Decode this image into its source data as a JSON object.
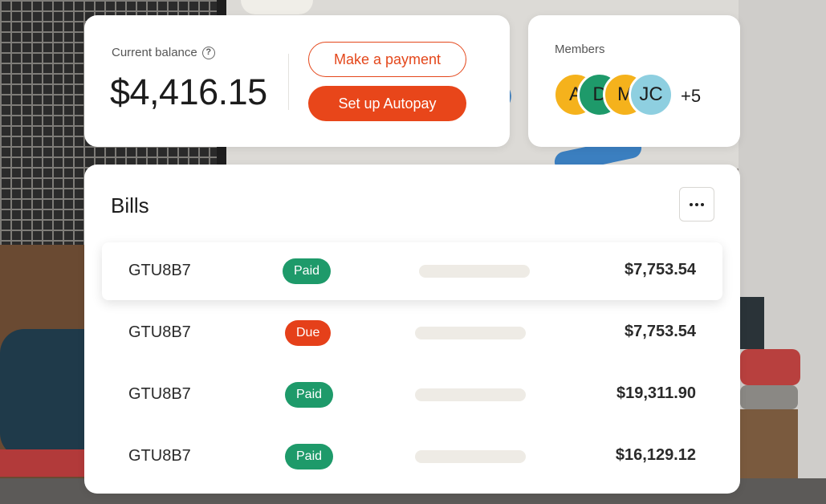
{
  "colors": {
    "accent": "#e8461a",
    "paid": "#1e9a6a",
    "due": "#e5401a",
    "placeholder": "#eeebe5"
  },
  "balance": {
    "label": "Current balance",
    "help_icon": "question-circle-icon",
    "help_glyph": "?",
    "amount": "$4,416.15",
    "make_payment": "Make a payment",
    "setup_autopay": "Set up Autopay"
  },
  "members": {
    "label": "Members",
    "avatars": [
      {
        "initials": "A",
        "color": "#f5b21c"
      },
      {
        "initials": "D",
        "color": "#1e9a6a"
      },
      {
        "initials": "M",
        "color": "#f5b21c"
      },
      {
        "initials": "JC",
        "color": "#8ecfe0"
      }
    ],
    "more": "+5"
  },
  "bills": {
    "title": "Bills",
    "more_icon": "ellipsis-icon",
    "rows": [
      {
        "id": "GTU8B7",
        "status": "Paid",
        "amount": "$7,753.54"
      },
      {
        "id": "GTU8B7",
        "status": "Due",
        "amount": "$7,753.54"
      },
      {
        "id": "GTU8B7",
        "status": "Paid",
        "amount": "$19,311.90"
      },
      {
        "id": "GTU8B7",
        "status": "Paid",
        "amount": "$16,129.12"
      }
    ]
  }
}
